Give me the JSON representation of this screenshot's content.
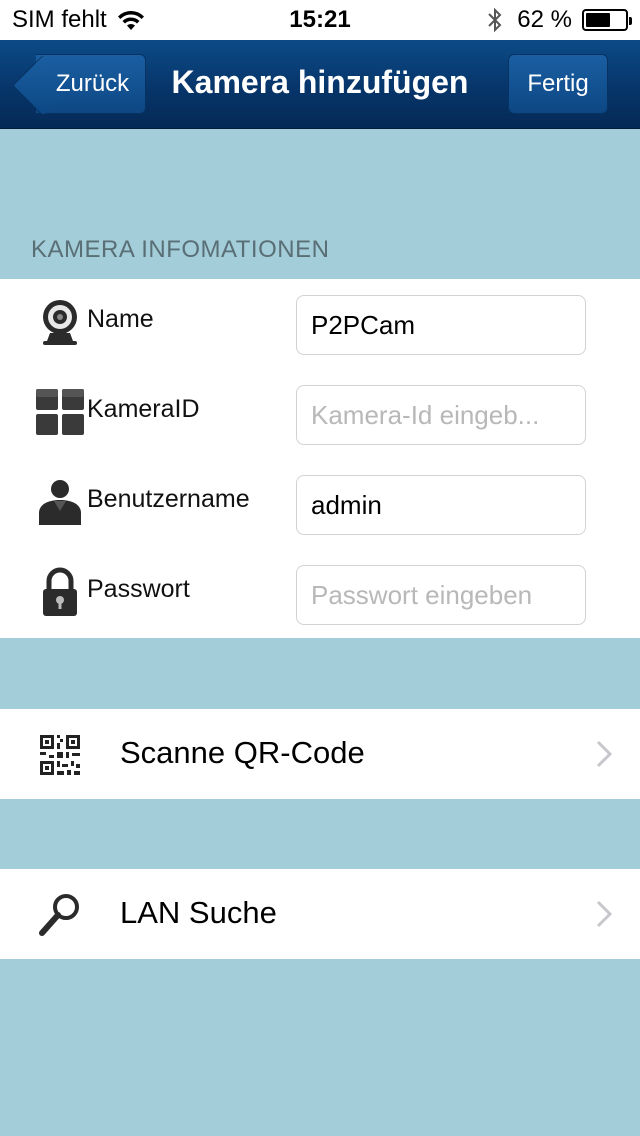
{
  "status_bar": {
    "carrier": "SIM fehlt",
    "time": "15:21",
    "battery_text": "62 %",
    "battery_level": 0.62
  },
  "nav": {
    "back_label": "Zurück",
    "title": "Kamera hinzufügen",
    "done_label": "Fertig"
  },
  "section_header": "KAMERA INFOMATIONEN",
  "form": {
    "name": {
      "label": "Name",
      "value": "P2PCam",
      "placeholder": "",
      "icon": "webcam-icon"
    },
    "camera_id": {
      "label": "KameraID",
      "value": "",
      "placeholder": "Kamera-Id eingeb...",
      "icon": "grid-icon"
    },
    "username": {
      "label": "Benutzername",
      "value": "admin",
      "placeholder": "",
      "icon": "user-icon"
    },
    "password": {
      "label": "Passwort",
      "value": "",
      "placeholder": "Passwort eingeben",
      "icon": "lock-icon"
    }
  },
  "actions": [
    {
      "label": "Scanne QR-Code",
      "icon": "qr-code-icon"
    },
    {
      "label": "LAN Suche",
      "icon": "magnifier-icon"
    }
  ],
  "colors": {
    "background": "#a3cdd9",
    "navbar": "#07356a",
    "section_header_text": "#5a6e75",
    "placeholder": "#b8b8b8"
  }
}
